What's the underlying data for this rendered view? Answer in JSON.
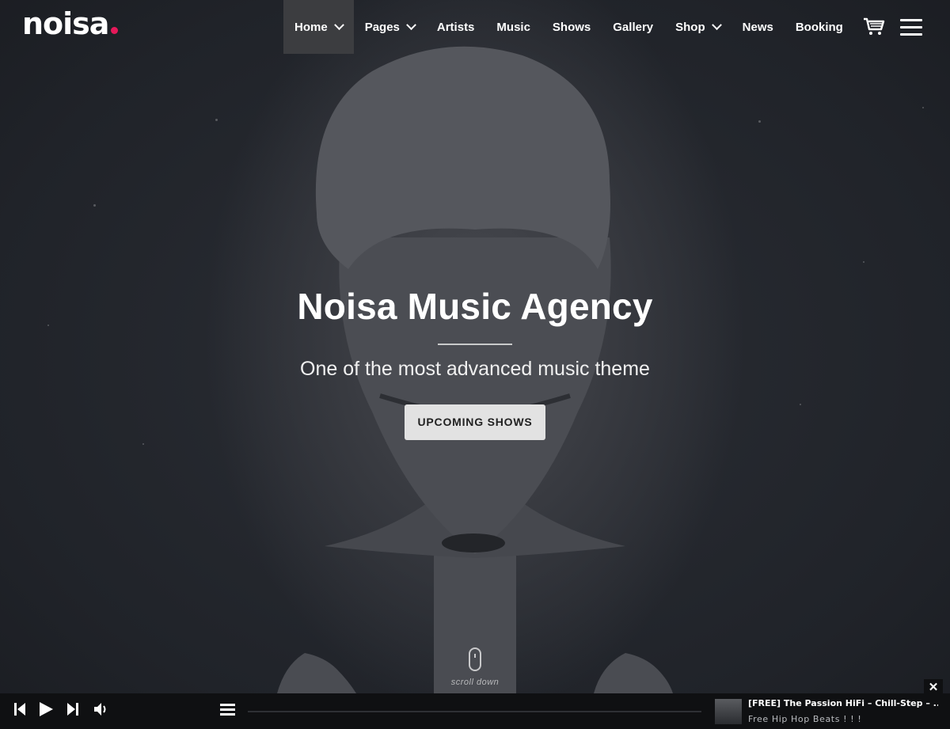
{
  "brand": {
    "name": "noisa",
    "accent": "#e6195a"
  },
  "nav": {
    "items": [
      {
        "label": "Home",
        "has_dropdown": true,
        "active": true
      },
      {
        "label": "Pages",
        "has_dropdown": true
      },
      {
        "label": "Artists"
      },
      {
        "label": "Music"
      },
      {
        "label": "Shows"
      },
      {
        "label": "Gallery"
      },
      {
        "label": "Shop",
        "has_dropdown": true
      },
      {
        "label": "News"
      },
      {
        "label": "Booking"
      }
    ],
    "icons": [
      "cart-icon",
      "hamburger-menu-icon"
    ]
  },
  "hero": {
    "title": "Noisa Music Agency",
    "subtitle": "One of the most advanced music theme",
    "button": "UPCOMING SHOWS",
    "scroll_label": "scroll down"
  },
  "player": {
    "controls": [
      "previous-icon",
      "play-icon",
      "next-icon",
      "volume-icon",
      "playlist-icon"
    ],
    "track_title": "[FREE] The Passion HiFi – Chill-Step – ...",
    "track_artist": "Free Hip Hop Beats ! ! !",
    "close_label": "✕"
  }
}
